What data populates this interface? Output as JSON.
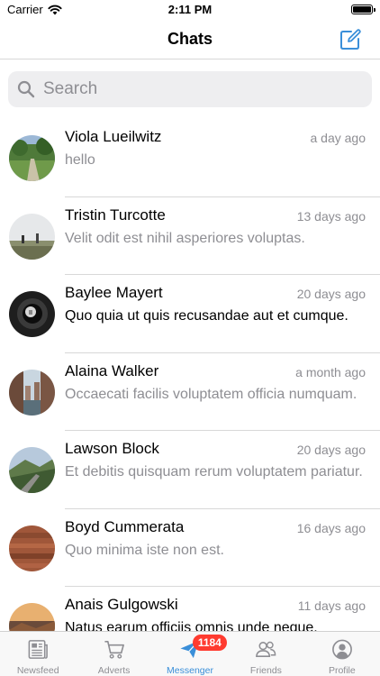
{
  "status_bar": {
    "carrier": "Carrier",
    "time": "2:11 PM"
  },
  "nav": {
    "title": "Chats",
    "compose_icon": "compose-icon"
  },
  "search": {
    "placeholder": "Search",
    "icon": "search-icon"
  },
  "chats": [
    {
      "name": "Viola Lueilwitz",
      "time": "a day ago",
      "message": "hello",
      "unread": false
    },
    {
      "name": "Tristin Turcotte",
      "time": "13 days ago",
      "message": "Velit odit est nihil asperiores voluptas.",
      "unread": false
    },
    {
      "name": "Baylee Mayert",
      "time": "20 days ago",
      "message": "Quo quia ut quis recusandae aut et cumque.",
      "unread": true
    },
    {
      "name": "Alaina Walker",
      "time": "a month ago",
      "message": "Occaecati facilis voluptatem officia numquam.",
      "unread": false
    },
    {
      "name": "Lawson Block",
      "time": "20 days ago",
      "message": "Et debitis quisquam rerum voluptatem pariatur.",
      "unread": false
    },
    {
      "name": "Boyd Cummerata",
      "time": "16 days ago",
      "message": "Quo minima iste non est.",
      "unread": false
    },
    {
      "name": "Anais Gulgowski",
      "time": "11 days ago",
      "message": "Natus earum officiis omnis unde neque.",
      "unread": true
    }
  ],
  "tabs": [
    {
      "label": "Newsfeed",
      "icon": "newspaper-icon",
      "active": false
    },
    {
      "label": "Adverts",
      "icon": "cart-icon",
      "active": false
    },
    {
      "label": "Messenger",
      "icon": "paper-plane-icon",
      "active": true,
      "badge": "1184"
    },
    {
      "label": "Friends",
      "icon": "people-icon",
      "active": false
    },
    {
      "label": "Profile",
      "icon": "user-circle-icon",
      "active": false
    }
  ],
  "colors": {
    "accent": "#3a8fd9",
    "badge": "#ff3b30",
    "secondary_text": "#8e8e93",
    "separator": "#d8d8d8"
  }
}
